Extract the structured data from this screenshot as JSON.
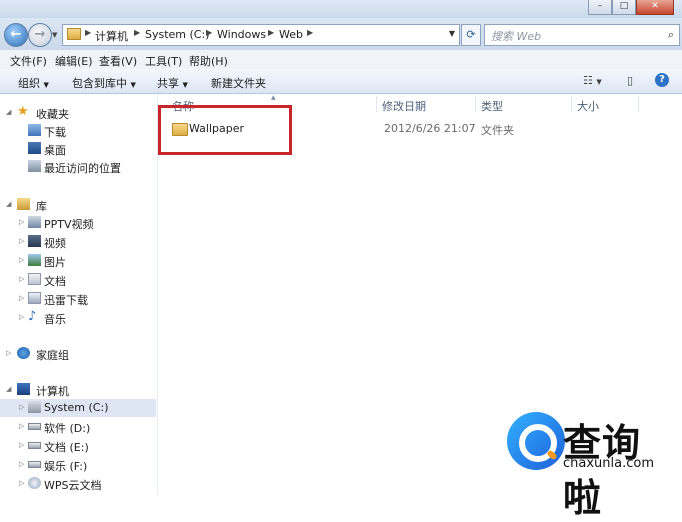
{
  "address": {
    "crumbs": [
      "计算机",
      "System (C:)",
      "Windows",
      "Web"
    ],
    "search_placeholder": "搜索 Web"
  },
  "menubar": [
    "文件(F)",
    "编辑(E)",
    "查看(V)",
    "工具(T)",
    "帮助(H)"
  ],
  "toolbar": {
    "organize": "组织",
    "include_library": "包含到库中",
    "share": "共享",
    "new_folder": "新建文件夹"
  },
  "nav": {
    "favorites": "收藏夹",
    "fav_items": [
      "下载",
      "桌面",
      "最近访问的位置"
    ],
    "library": "库",
    "lib_items": [
      "PPTV视频",
      "视频",
      "图片",
      "文档",
      "迅雷下载",
      "音乐"
    ],
    "homegroup": "家庭组",
    "computer": "计算机",
    "drives": [
      "System (C:)",
      "软件 (D:)",
      "文档 (E:)",
      "娱乐 (F:)",
      "WPS云文档"
    ]
  },
  "columns": [
    "名称",
    "修改日期",
    "类型",
    "大小"
  ],
  "files": [
    {
      "name": "Wallpaper",
      "date": "2012/6/26 21:07",
      "type": "文件夹",
      "size": ""
    }
  ],
  "watermark": {
    "name": "查询啦",
    "url": "chaxunla.com"
  },
  "colors": {
    "highlight": "#c8262b",
    "accent": "#2e6db4"
  }
}
